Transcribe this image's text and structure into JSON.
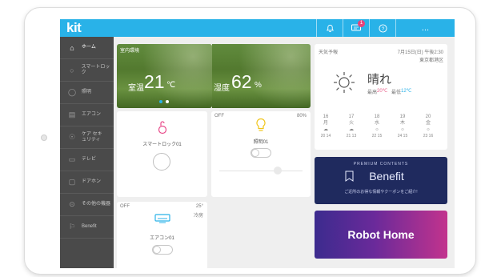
{
  "app": {
    "logo": "kit"
  },
  "topbar": {
    "notification_badge": "1",
    "help_icon_glyph": "?",
    "more_glyph": "..."
  },
  "sidebar": {
    "items": [
      {
        "label": "ホーム",
        "icon": "home-icon"
      },
      {
        "label": "スマートロック",
        "icon": "lock-icon"
      },
      {
        "label": "照明",
        "icon": "bulb-icon"
      },
      {
        "label": "エアコン",
        "icon": "aircon-icon"
      },
      {
        "label": "ケア セキュリティ",
        "icon": "shield-icon"
      },
      {
        "label": "テレビ",
        "icon": "tv-icon"
      },
      {
        "label": "ドアホン",
        "icon": "intercom-icon"
      },
      {
        "label": "その他の機器",
        "icon": "more-devices-icon"
      },
      {
        "label": "Benefit",
        "icon": "benefit-icon"
      }
    ]
  },
  "environment": {
    "title": "室内環境",
    "temp_label": "室温",
    "temp_value": "21",
    "temp_unit": "℃",
    "humidity_label": "湿度",
    "humidity_value": "62",
    "humidity_unit": "%"
  },
  "devices": {
    "lock": {
      "name": "スマートロック01"
    },
    "light": {
      "status": "OFF",
      "brightness": "80%",
      "name": "照明01"
    },
    "aircon": {
      "status": "OFF",
      "temp": "25°",
      "mode": "冷房",
      "name": "エアコン01"
    }
  },
  "weather": {
    "title": "天気予報",
    "date": "7月15日(日) 午後2:30",
    "location": "東京都港区",
    "condition": "晴れ",
    "high_label": "最高",
    "high": "20℃",
    "low_label": "最低",
    "low": "12℃",
    "forecast": [
      {
        "day": "16",
        "dow": "月",
        "temp": "20 14"
      },
      {
        "day": "17",
        "dow": "火",
        "temp": "21 13"
      },
      {
        "day": "18",
        "dow": "水",
        "temp": "22 15"
      },
      {
        "day": "19",
        "dow": "木",
        "temp": "24 15"
      },
      {
        "day": "20",
        "dow": "金",
        "temp": "23 16"
      }
    ]
  },
  "premium": {
    "tag": "PREMIUM CONTENTS",
    "title": "Benefit",
    "desc": "ご近所のお得な情報やクーポンをご紹介!"
  },
  "robot": {
    "label": "Robot Home"
  },
  "colors": {
    "topbar": "#29b2e8",
    "sidebar": "#4a4a4a",
    "accent_pink": "#e7437a",
    "lock_pink": "#e84a8a",
    "bulb_yellow": "#f0c419",
    "premium_bg": "#1f2a5e"
  }
}
